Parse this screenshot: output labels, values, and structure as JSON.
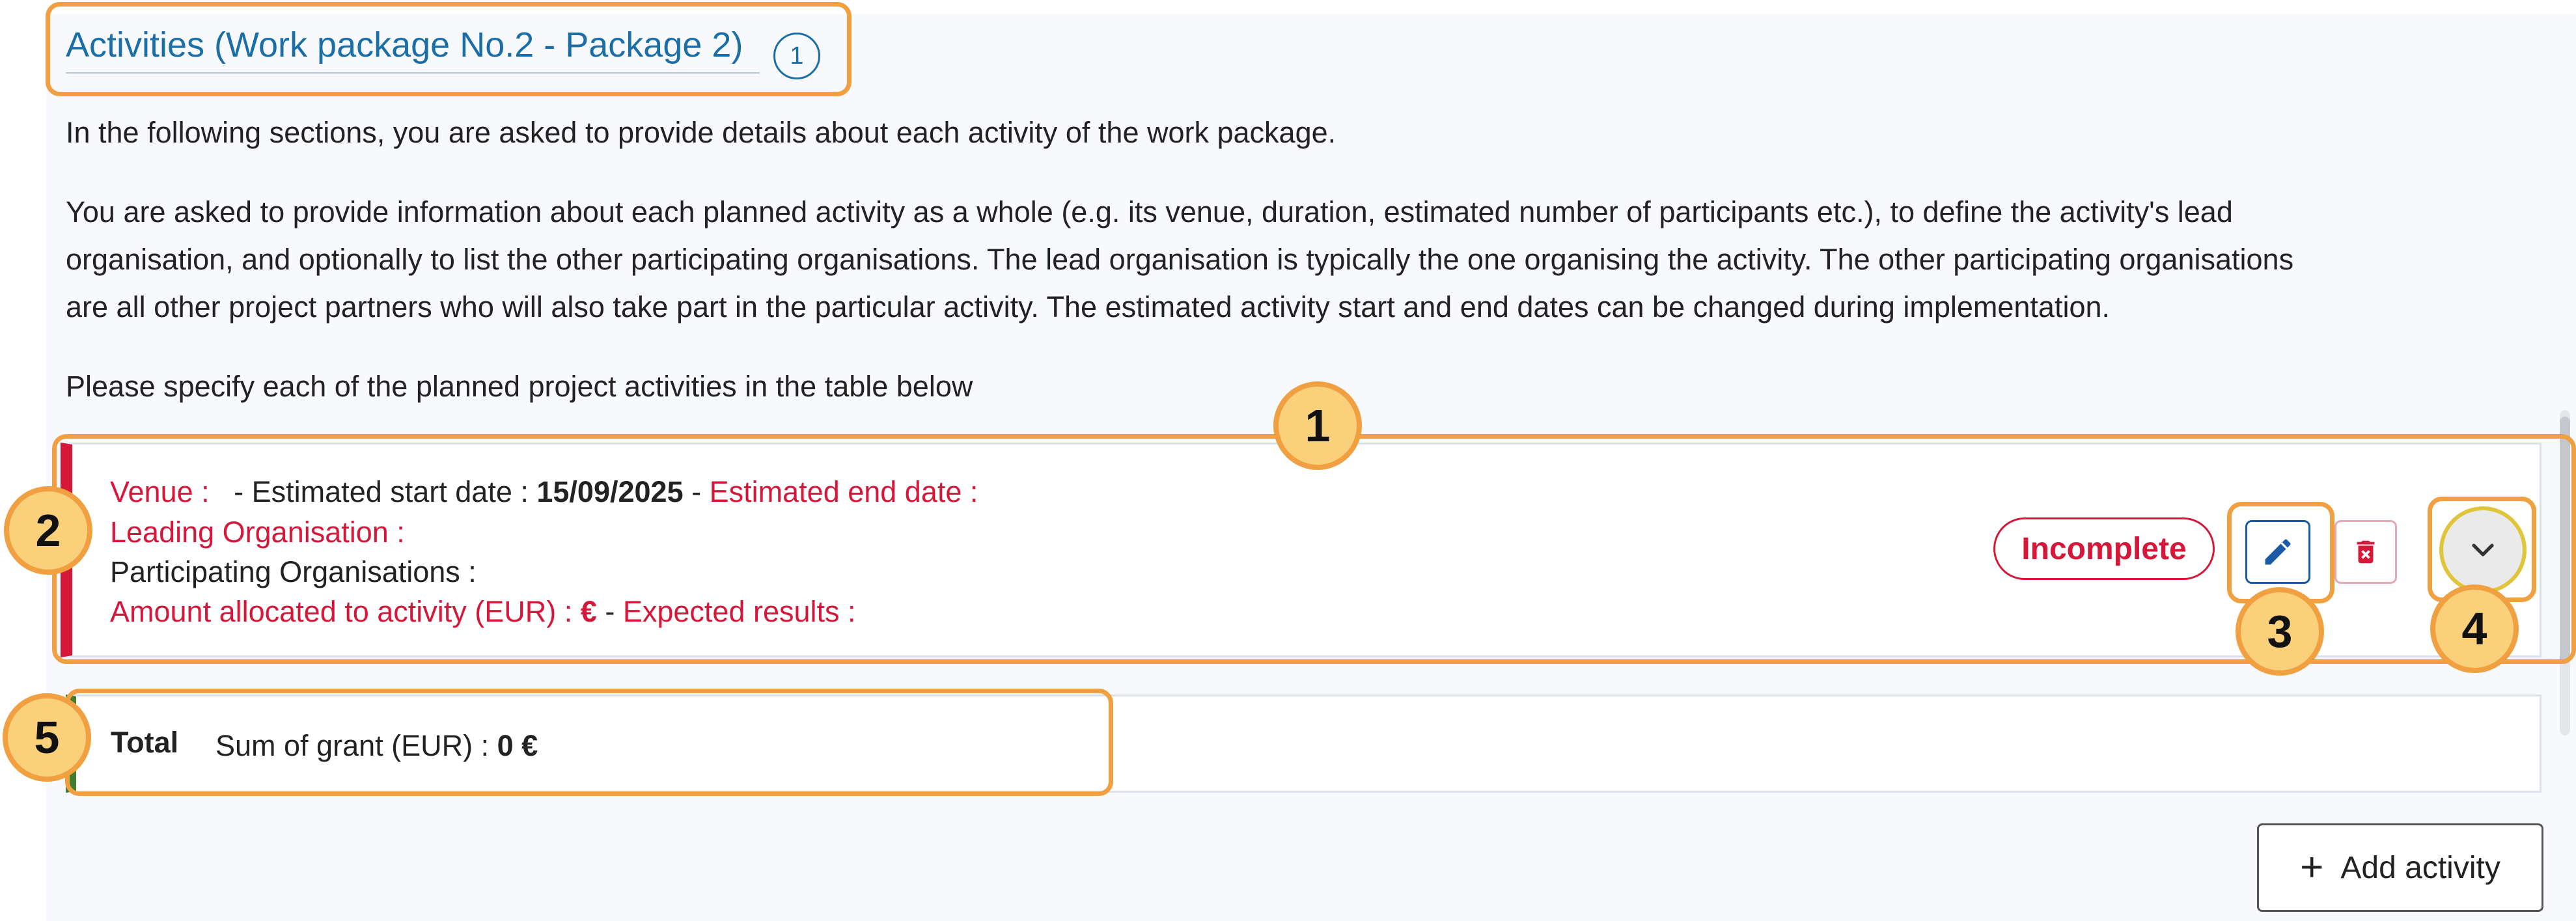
{
  "section": {
    "title": "Activities (Work package No.2 - Package 2)",
    "help_badge": "1"
  },
  "paragraphs": {
    "intro": "In the following sections, you are asked to provide details about each activity of the work package.",
    "details_line1": "You are asked to provide information about each planned activity as a whole (e.g. its venue, duration, estimated number of participants etc.), to define the activity's lead",
    "details_line2": "organisation, and optionally to list the other participating organisations. The lead organisation is typically the one organising the activity. The other participating organisations",
    "details_line3": "are all other project partners who will also take part in the particular activity. The estimated activity start and end dates can be changed during implementation.",
    "instruction": "Please specify each of the planned project activities in the table below"
  },
  "activity": {
    "venue_label": "Venue :",
    "start_label": "- Estimated start date :",
    "start_value": "15/09/2025",
    "dash": "-",
    "end_label": "Estimated end date :",
    "leading_label": "Leading Organisation :",
    "participating_label": "Participating Organisations :",
    "amount_label": "Amount allocated to activity (EUR) :",
    "amount_value": "€",
    "amount_dash": "-",
    "results_label": "Expected results :",
    "status": "Incomplete"
  },
  "total": {
    "label": "Total",
    "sum_label": "Sum of grant (EUR) :",
    "sum_value": "0 €"
  },
  "add_activity": {
    "plus": "+",
    "label": "Add activity"
  },
  "annotations": {
    "one": "1",
    "two": "2",
    "three": "3",
    "four": "4",
    "five": "5"
  },
  "colors": {
    "link_blue": "#1b6fa6",
    "required_red": "#d5183a",
    "annotation_orange": "#f0a040",
    "annotation_fill": "#fbd07a",
    "total_green": "#3f7d2c"
  },
  "icons": {
    "edit": "pencil-icon",
    "delete": "trash-icon",
    "expand": "chevron-down-icon",
    "add": "plus-icon"
  }
}
